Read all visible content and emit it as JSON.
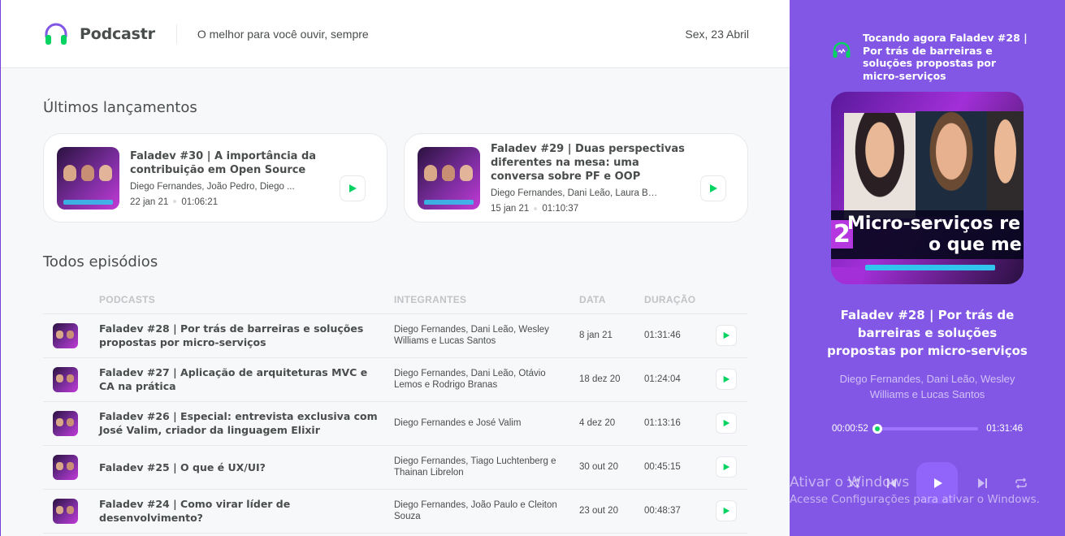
{
  "header": {
    "logo_text": "Podcastr",
    "tagline": "O melhor para você ouvir, sempre",
    "date": "Sex, 23 Abril"
  },
  "latest": {
    "title": "Últimos lançamentos",
    "episodes": [
      {
        "title": "Faladev #30 | A importância da contribuição em Open Source",
        "members": "Diego Fernandes, João Pedro, Diego ...",
        "date": "22 jan 21",
        "duration": "01:06:21"
      },
      {
        "title": "Faladev #29 | Duas perspectivas diferentes na mesa: uma conversa sobre PF e OOP",
        "members": "Diego Fernandes, Dani Leão, Laura Beat...",
        "date": "15 jan 21",
        "duration": "01:10:37"
      }
    ]
  },
  "all": {
    "title": "Todos episódios",
    "columns": [
      "",
      "Podcasts",
      "Integrantes",
      "Data",
      "Duração",
      ""
    ],
    "rows": [
      {
        "title": "Faladev #28 | Por trás de barreiras e soluções propostas por micro-serviços",
        "members": "Diego Fernandes, Dani Leão, Wesley Williams e Lucas Santos",
        "date": "8 jan 21",
        "duration": "01:31:46"
      },
      {
        "title": "Faladev #27 | Aplicação de arquiteturas MVC e CA na prática",
        "members": "Diego Fernandes, Dani Leão, Otávio Lemos e Rodrigo Branas",
        "date": "18 dez 20",
        "duration": "01:24:04"
      },
      {
        "title": "Faladev #26 | Especial: entrevista exclusiva com José Valim, criador da linguagem Elixir",
        "members": "Diego Fernandes e José Valim",
        "date": "4 dez 20",
        "duration": "01:13:16"
      },
      {
        "title": "Faladev #25 | O que é UX/UI?",
        "members": "Diego Fernandes, Tiago Luchtenberg e Thainan Librelon",
        "date": "30 out 20",
        "duration": "00:45:15"
      },
      {
        "title": "Faladev #24 | Como virar líder de desenvolvimento?",
        "members": "Diego Fernandes, João Paulo e Cleiton Souza",
        "date": "23 out 20",
        "duration": "00:48:37"
      }
    ]
  },
  "player": {
    "now_playing": "Tocando agora Faladev #28 | Por trás de barreiras e soluções propostas por micro-serviços",
    "cover_text_1": "Micro-serviços re",
    "cover_text_2": "o que me",
    "cover_number": "2",
    "title": "Faladev #28 | Por trás de barreiras e soluções propostas por micro-serviços",
    "members": "Diego Fernandes, Dani Leão, Wesley Williams e Lucas Santos",
    "current_time": "00:00:52",
    "total_time": "01:31:46",
    "progress": 0.01
  },
  "watermark": {
    "line1": "Ativar o Windows",
    "line2": "Acesse Configurações para ativar o Windows."
  },
  "colors": {
    "accent": "#8257e5",
    "green": "#04d361",
    "text": "#494d4b"
  },
  "icons": [
    "headphones-icon",
    "play-icon",
    "shuffle-icon",
    "previous-icon",
    "next-icon",
    "repeat-icon"
  ]
}
